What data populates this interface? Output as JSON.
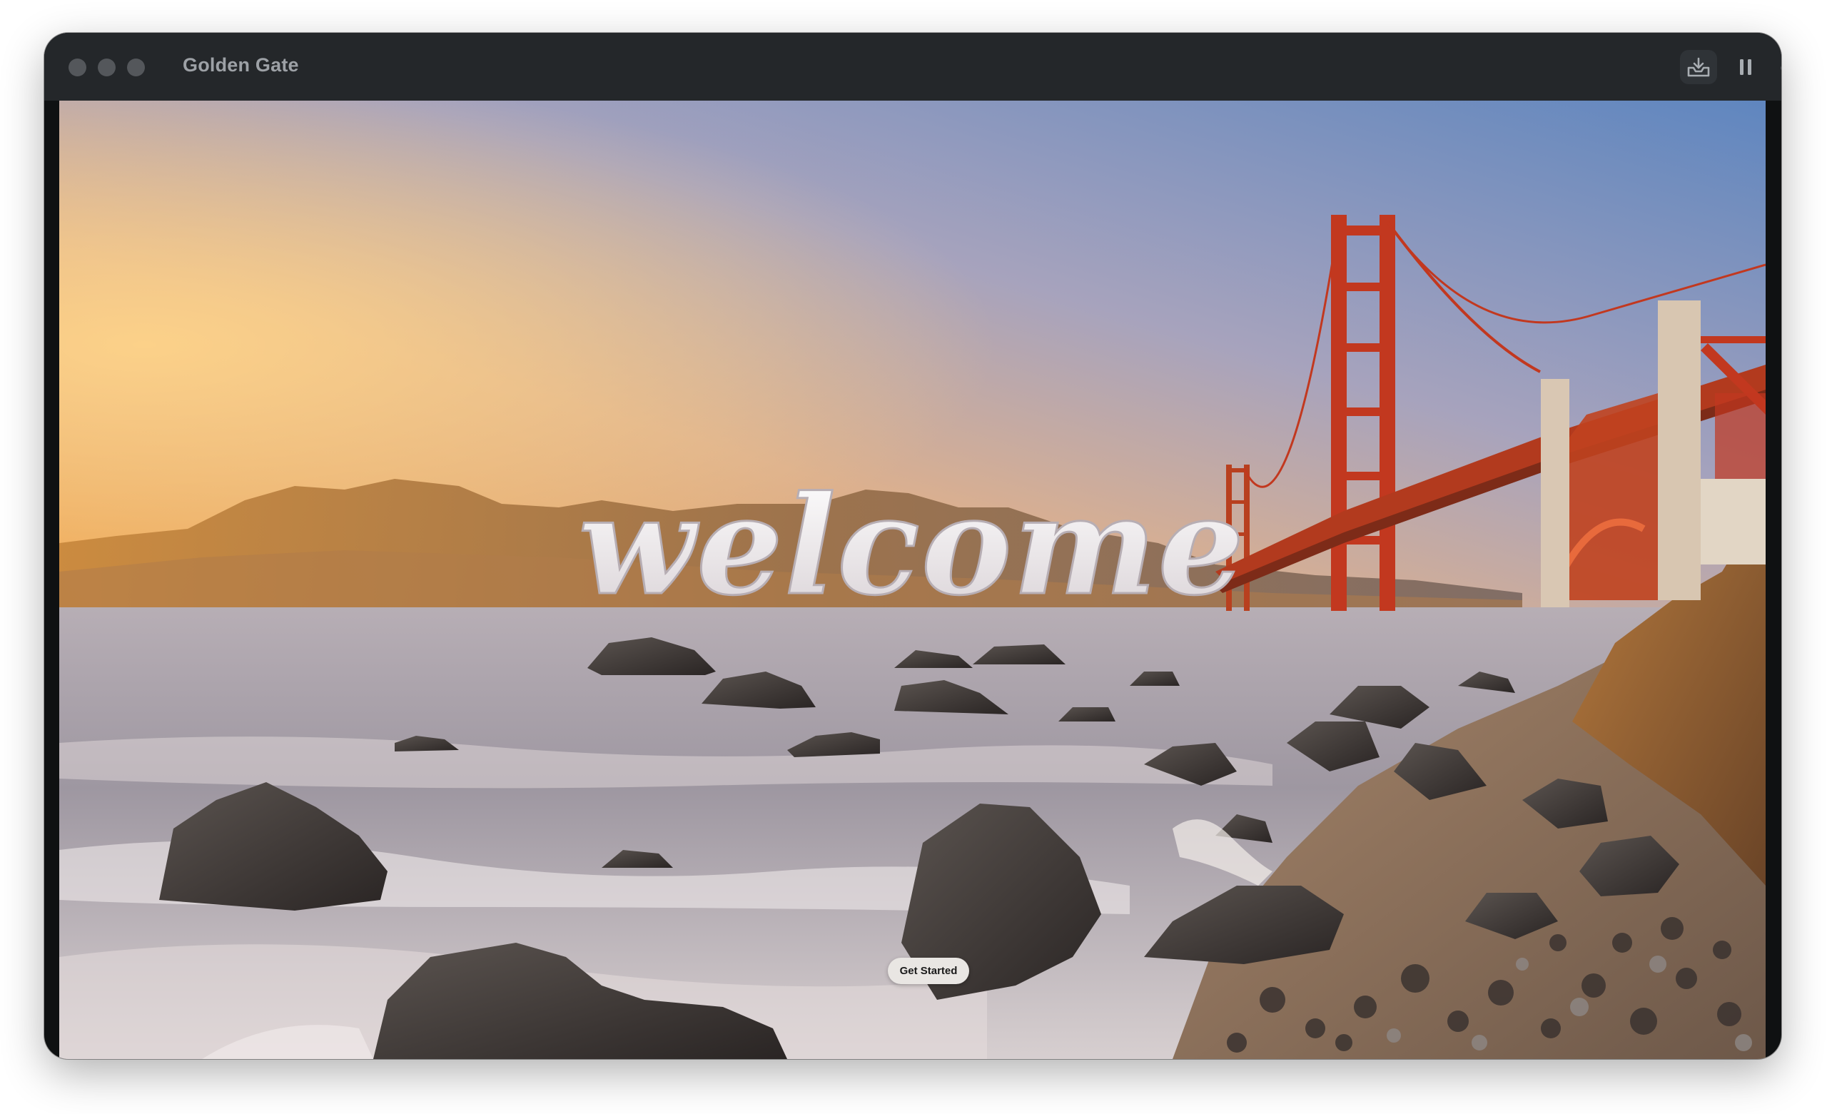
{
  "window": {
    "title": "Golden Gate"
  },
  "toolbar": {
    "install_icon": "tray-download-icon",
    "pause_icon": "pause-icon",
    "power_icon": "power-icon"
  },
  "screen": {
    "welcome_text": "welcome",
    "get_started_label": "Get Started",
    "background_description_icon": "golden-gate-beach-wallpaper"
  },
  "colors": {
    "titlebar": "#24272a",
    "window_frame": "#0f1112",
    "title_text": "#9da1a6",
    "traffic_lights": "#54575b",
    "bridge": "#c2381f",
    "welcome": "#f3eeee",
    "button_bg": "#e9e6e3"
  }
}
